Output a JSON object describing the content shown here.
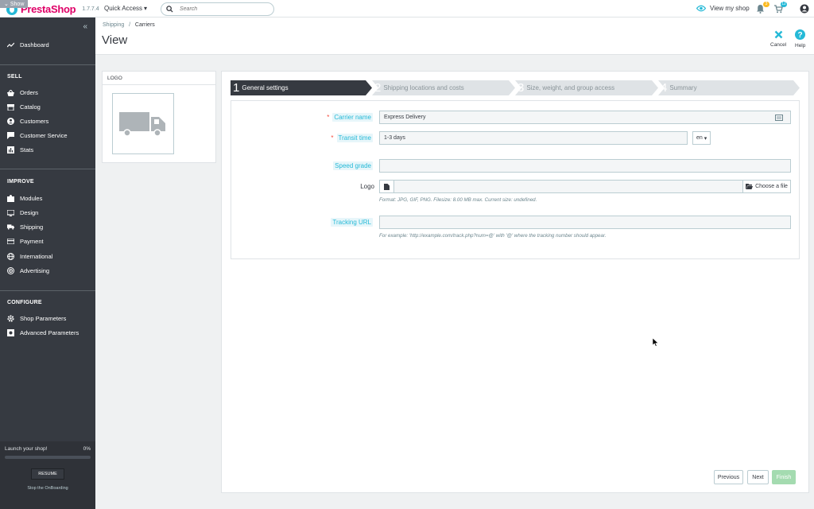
{
  "topbar": {
    "show_tag": "Show",
    "brand_name": "PrestaShop",
    "version": "1.7.7.4",
    "quick_access": "Quick Access",
    "search_placeholder": "Search",
    "view_shop": "View my shop",
    "notifications_count": "3",
    "orders_count": "12"
  },
  "sidebar": {
    "dashboard": "Dashboard",
    "sections": {
      "sell": "SELL",
      "improve": "IMPROVE",
      "configure": "CONFIGURE"
    },
    "sell_items": [
      "Orders",
      "Catalog",
      "Customers",
      "Customer Service",
      "Stats"
    ],
    "improve_items": [
      "Modules",
      "Design",
      "Shipping",
      "Payment",
      "International",
      "Advertising"
    ],
    "configure_items": [
      "Shop Parameters",
      "Advanced Parameters"
    ],
    "onboarding": {
      "title": "Launch your shop!",
      "percent": "0%",
      "progress": 0,
      "resume": "RESUME",
      "stop": "Stop the OnBoarding"
    }
  },
  "header": {
    "breadcrumb_parent": "Shipping",
    "breadcrumb_current": "Carriers",
    "title": "View",
    "cancel": "Cancel",
    "help": "Help"
  },
  "logo_card": {
    "title": "LOGO"
  },
  "wizard": {
    "steps": [
      {
        "num": "1",
        "label": "General settings",
        "active": true
      },
      {
        "num": "2",
        "label": "Shipping locations and costs",
        "active": false
      },
      {
        "num": "3",
        "label": "Size, weight, and group access",
        "active": false
      },
      {
        "num": "4",
        "label": "Summary",
        "active": false
      }
    ]
  },
  "form": {
    "carrier_name_label": "Carrier name",
    "carrier_name_value": "Express Delivery",
    "transit_time_label": "Transit time",
    "transit_time_value": "1-3 days",
    "lang": "en",
    "speed_grade_label": "Speed grade",
    "speed_grade_value": "",
    "logo_label": "Logo",
    "choose_file": "Choose a file",
    "logo_help": "Format: JPG, GIF, PNG. Filesize: 8.00 MB max. Current size: undefined.",
    "tracking_url_label": "Tracking URL",
    "tracking_url_value": "",
    "tracking_help": "For example: 'http://example.com/track.php?num=@' with '@' where the tracking number should appear."
  },
  "footer_buttons": {
    "previous": "Previous",
    "next": "Next",
    "finish": "Finish"
  },
  "colors": {
    "accent": "#25b9d7",
    "brand": "#df0067",
    "sidebar": "#363a41",
    "finish": "#a4dbb0"
  }
}
